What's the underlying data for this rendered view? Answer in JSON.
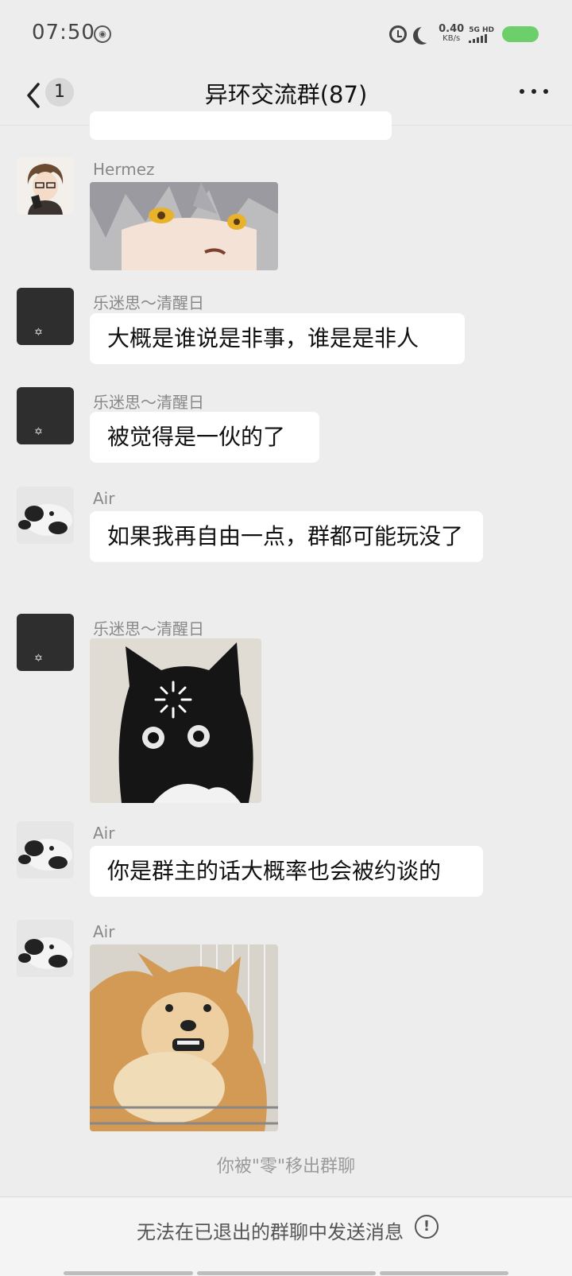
{
  "status": {
    "time": "07:50",
    "net_speed_value": "0.40",
    "net_speed_unit": "KB/s",
    "signal_label": "5G HD"
  },
  "nav": {
    "unread_count": "1",
    "title": "异环交流群(87)"
  },
  "messages": [
    {
      "sender": "Hermez",
      "type": "sticker",
      "sticker": "anime-girl-sticker"
    },
    {
      "sender": "乐迷思～清醒日",
      "type": "text",
      "text": "大概是谁说是非事，谁是是非人"
    },
    {
      "sender": "乐迷思～清醒日",
      "type": "text",
      "text": "被觉得是一伙的了"
    },
    {
      "sender": "Air",
      "type": "text",
      "text": "如果我再自由一点，群都可能玩没了"
    },
    {
      "sender": "乐迷思～清醒日",
      "type": "sticker",
      "sticker": "loading-cat-sticker"
    },
    {
      "sender": "Air",
      "type": "text",
      "text": "你是群主的话大概率也会被约谈的"
    },
    {
      "sender": "Air",
      "type": "sticker",
      "sticker": "shiba-dog-sticker"
    }
  ],
  "system_note": "你被\"零\"移出群聊",
  "footer": {
    "text": "无法在已退出的群聊中发送消息"
  },
  "colors": {
    "background": "#ededed",
    "bubble": "#ffffff",
    "battery": "#6dcf6a"
  }
}
